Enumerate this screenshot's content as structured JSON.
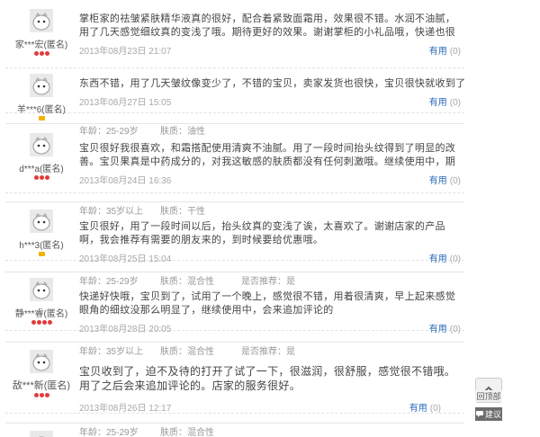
{
  "labels": {
    "age": "年龄：",
    "skin": "肤质：",
    "recommend": "是否推荐：",
    "useful": "有用"
  },
  "reviews": [
    {
      "user": "家***宏(匿名)",
      "level": "red3",
      "age": "",
      "skin": "",
      "recommend": "",
      "attrs_visible": false,
      "text": "掌柜家的祛皱紧肤精华液真的很好，配合着紧致面霜用，效果很不错。水润不油腻，用了几天感觉细纹真的变浅了哦。期待更好的效果。谢谢掌柜的小礼品哦，快递也很快。",
      "date": "2013年08月23日 21:07",
      "useful_count": "(0)"
    },
    {
      "user": "羊***6(匿名)",
      "level": "yellow",
      "age": "",
      "skin": "",
      "recommend": "",
      "attrs_visible": false,
      "text": "东西不错，用了几天皱纹像变少了，不错的宝贝，卖家发货也很快，宝贝很快就收到了，不错的卖家",
      "date": "2013年08月27日 15:05",
      "useful_count": "(0)"
    },
    {
      "user": "d***a(匿名)",
      "level": "red3",
      "age": "25-29岁",
      "skin": "油性",
      "recommend": "",
      "attrs_visible": true,
      "text": "宝贝很好我很喜欢，和霜搭配使用清爽不油腻。用了一段时间抬头纹得到了明显的改善。宝贝果真是中药成分的，对我这敏感的肤质都没有任何刺激哦。继续使用中，期待所有的纹通通消失。店家态度好，还送了小礼物呢",
      "date": "2013年08月24日 16:36",
      "useful_count": "(0)"
    },
    {
      "user": "h***3(匿名)",
      "level": "yellow",
      "age": "35岁以上",
      "skin": "干性",
      "recommend": "",
      "attrs_visible": true,
      "text": "宝贝很好，用了一段时间以后，抬头纹真的变浅了诶，太喜欢了。谢谢店家的产品啊，我会推荐有需要的朋友来的，到时候要给优惠哦。",
      "date": "2013年08月25日 15:04",
      "useful_count": "(0)"
    },
    {
      "user": "静***睿(匿名)",
      "level": "red4",
      "age": "25-29岁",
      "skin": "混合性",
      "recommend": "是",
      "attrs_visible": true,
      "text": "快递好快哦，宝贝到了，试用了一个晚上，感觉很不错，用着很清爽，早上起来感觉眼角的细纹没那么明显了，继续使用中，会来追加评论的",
      "date": "2013年08月28日 20:05",
      "useful_count": "(0)"
    },
    {
      "user": "敌***新(匿名)",
      "level": "red3",
      "age": "35岁以上",
      "skin": "混合性",
      "recommend": "是",
      "attrs_visible": true,
      "text": "宝贝收到了，迫不及待的打开了试了一下，很滋润，很舒服，感觉很不错哦。用了之后会来追加评论的。店家的服务很好。",
      "date": "2013年08月26日 12:17",
      "useful_count": "(0)"
    },
    {
      "user": "",
      "level": "none",
      "age": "25-29岁",
      "skin": "混合性",
      "recommend": "",
      "attrs_visible": true,
      "text": "",
      "date": "",
      "useful_count": ""
    }
  ],
  "side": {
    "back_to_top": "回顶部",
    "suggest": "建议"
  }
}
